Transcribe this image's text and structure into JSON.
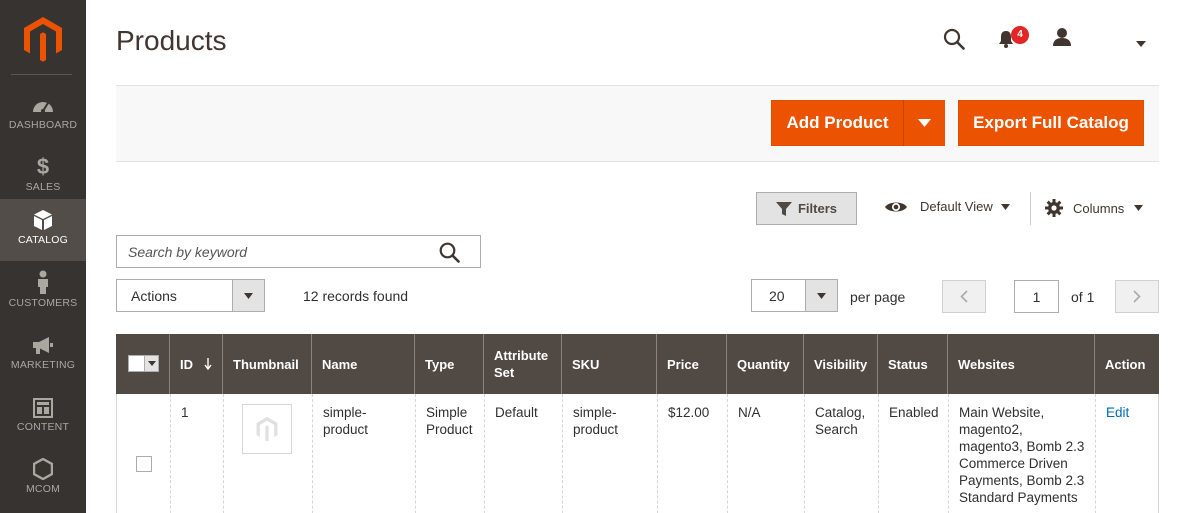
{
  "colors": {
    "sidebar": "#373330",
    "accent": "#eb5202",
    "grid_header": "#514943",
    "link": "#006bb4",
    "badge": "#e22626"
  },
  "sidebar": {
    "logo_icon": "magento-logo-icon",
    "items": [
      {
        "label": "DASHBOARD",
        "icon": "dashboard-icon",
        "active": false
      },
      {
        "label": "SALES",
        "icon": "dollar-icon",
        "active": false
      },
      {
        "label": "CATALOG",
        "icon": "box-icon",
        "active": true
      },
      {
        "label": "CUSTOMERS",
        "icon": "person-icon",
        "active": false
      },
      {
        "label": "MARKETING",
        "icon": "megaphone-icon",
        "active": false
      },
      {
        "label": "CONTENT",
        "icon": "layout-icon",
        "active": false
      },
      {
        "label": "MCOM",
        "icon": "hexagon-icon",
        "active": false
      }
    ]
  },
  "header": {
    "title": "Products",
    "notifications_count": "4"
  },
  "action_bar": {
    "add_product": "Add Product",
    "export": "Export Full Catalog"
  },
  "toolbar": {
    "filters": "Filters",
    "view": "Default View",
    "columns": "Columns",
    "search_placeholder": "Search by keyword",
    "actions": "Actions",
    "records": "12 records found",
    "per_page_value": "20",
    "per_page_label": "per page",
    "page_value": "1",
    "page_of": "of 1"
  },
  "grid": {
    "columns": [
      "ID",
      "Thumbnail",
      "Name",
      "Type",
      "Attribute Set",
      "SKU",
      "Price",
      "Quantity",
      "Visibility",
      "Status",
      "Websites",
      "Action"
    ],
    "rows": [
      {
        "id": "1",
        "name": "simple-product",
        "type": "Simple Product",
        "attribute_set": "Default",
        "sku": "simple-product",
        "price": "$12.00",
        "quantity": "N/A",
        "visibility": "Catalog, Search",
        "status": "Enabled",
        "websites": "Main Website, magento2, magento3, Bomb 2.3 Commerce Driven Payments, Bomb 2.3 Standard Payments",
        "action": "Edit"
      }
    ]
  }
}
